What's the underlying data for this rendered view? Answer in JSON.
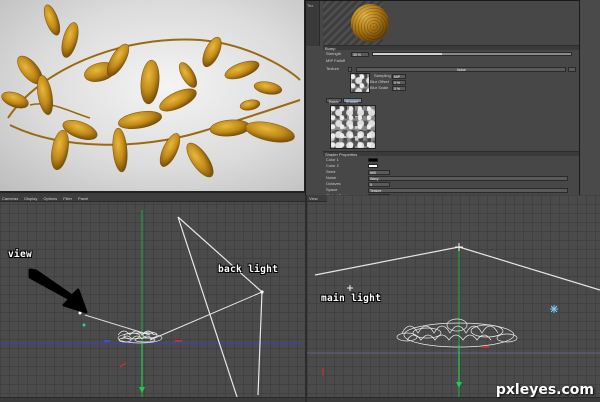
{
  "render": {
    "leaf_color": "#c8911c",
    "bg_color": "#e4e4e4"
  },
  "panel": {
    "side_tab": "Tex",
    "sphere_color": "#b07a17",
    "bump_header": "Bump",
    "strength_label": "Strength",
    "strength_value": "35 %",
    "mip_label": "MIP Falloff",
    "texture_label": "Texture",
    "texture_type": "Noise",
    "sampling_label": "Sampling",
    "sampling_value": "MIP",
    "blur_offset_label": "Blur Offset",
    "blur_offset_value": "0 %",
    "blur_scale_label": "Blur Scale",
    "blur_scale_value": "0 %",
    "subtabs": [
      "Basic",
      "Shader"
    ],
    "shader_header": "Shader Properties",
    "props": [
      {
        "label": "Color 1",
        "value": ""
      },
      {
        "label": "Color 2",
        "value": ""
      },
      {
        "label": "Seed",
        "value": "665"
      },
      {
        "label": "Noise",
        "value": "Wavy"
      },
      {
        "label": "Octaves",
        "value": "5"
      },
      {
        "label": "Space",
        "value": "Texture"
      },
      {
        "label": "Global Scale",
        "value": "100 %"
      },
      {
        "label": "Relative Scale",
        "value": "100 %"
      },
      {
        "label": "Animation Speed",
        "value": "0"
      },
      {
        "label": "Loop Period",
        "value": "0"
      },
      {
        "label": "Detail Attenuation",
        "value": "100 %"
      }
    ],
    "rel_scale_y": "100 %",
    "rel_scale_z": "100 %"
  },
  "viewport_left": {
    "menu": [
      "Cameras",
      "Display",
      "Options",
      "Filter",
      "Panel"
    ]
  },
  "viewport_right": {
    "menu": [
      "View",
      "Cam",
      "Panel"
    ]
  },
  "annotations": {
    "view": "view",
    "back_light": "back light",
    "main_light": "main light"
  },
  "watermark": "pxleyes.com"
}
